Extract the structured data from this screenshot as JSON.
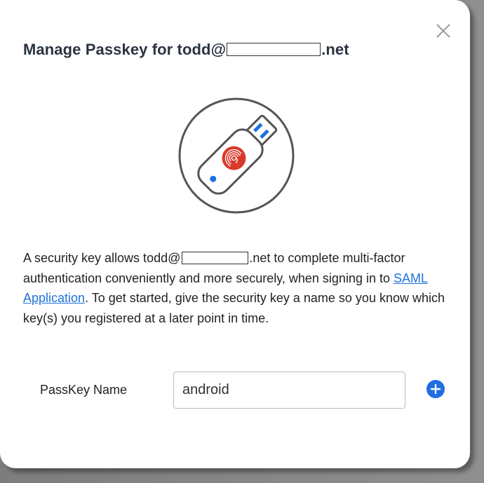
{
  "dialog": {
    "title_prefix": "Manage Passkey for todd@",
    "title_suffix": ".net",
    "close_icon": "close-icon"
  },
  "hero": {
    "icon": "usb-security-key-fingerprint-icon",
    "colors": {
      "ring": "#555555",
      "key_body": "#555555",
      "fingerprint": "#d93a2b",
      "led": "#1f6fe0"
    }
  },
  "description": {
    "text_1": "A security key allows todd@",
    "text_2": ".net to complete multi-factor authentication conveniently and more securely, when signing in to ",
    "link": "SAML Application",
    "text_3": ". To get started, give the security key a name so you know which key(s) you registered at a later point in time."
  },
  "form": {
    "label": "PassKey Name",
    "value": "android",
    "add_icon": "plus-circle-icon",
    "accent": "#1f6fe0"
  }
}
